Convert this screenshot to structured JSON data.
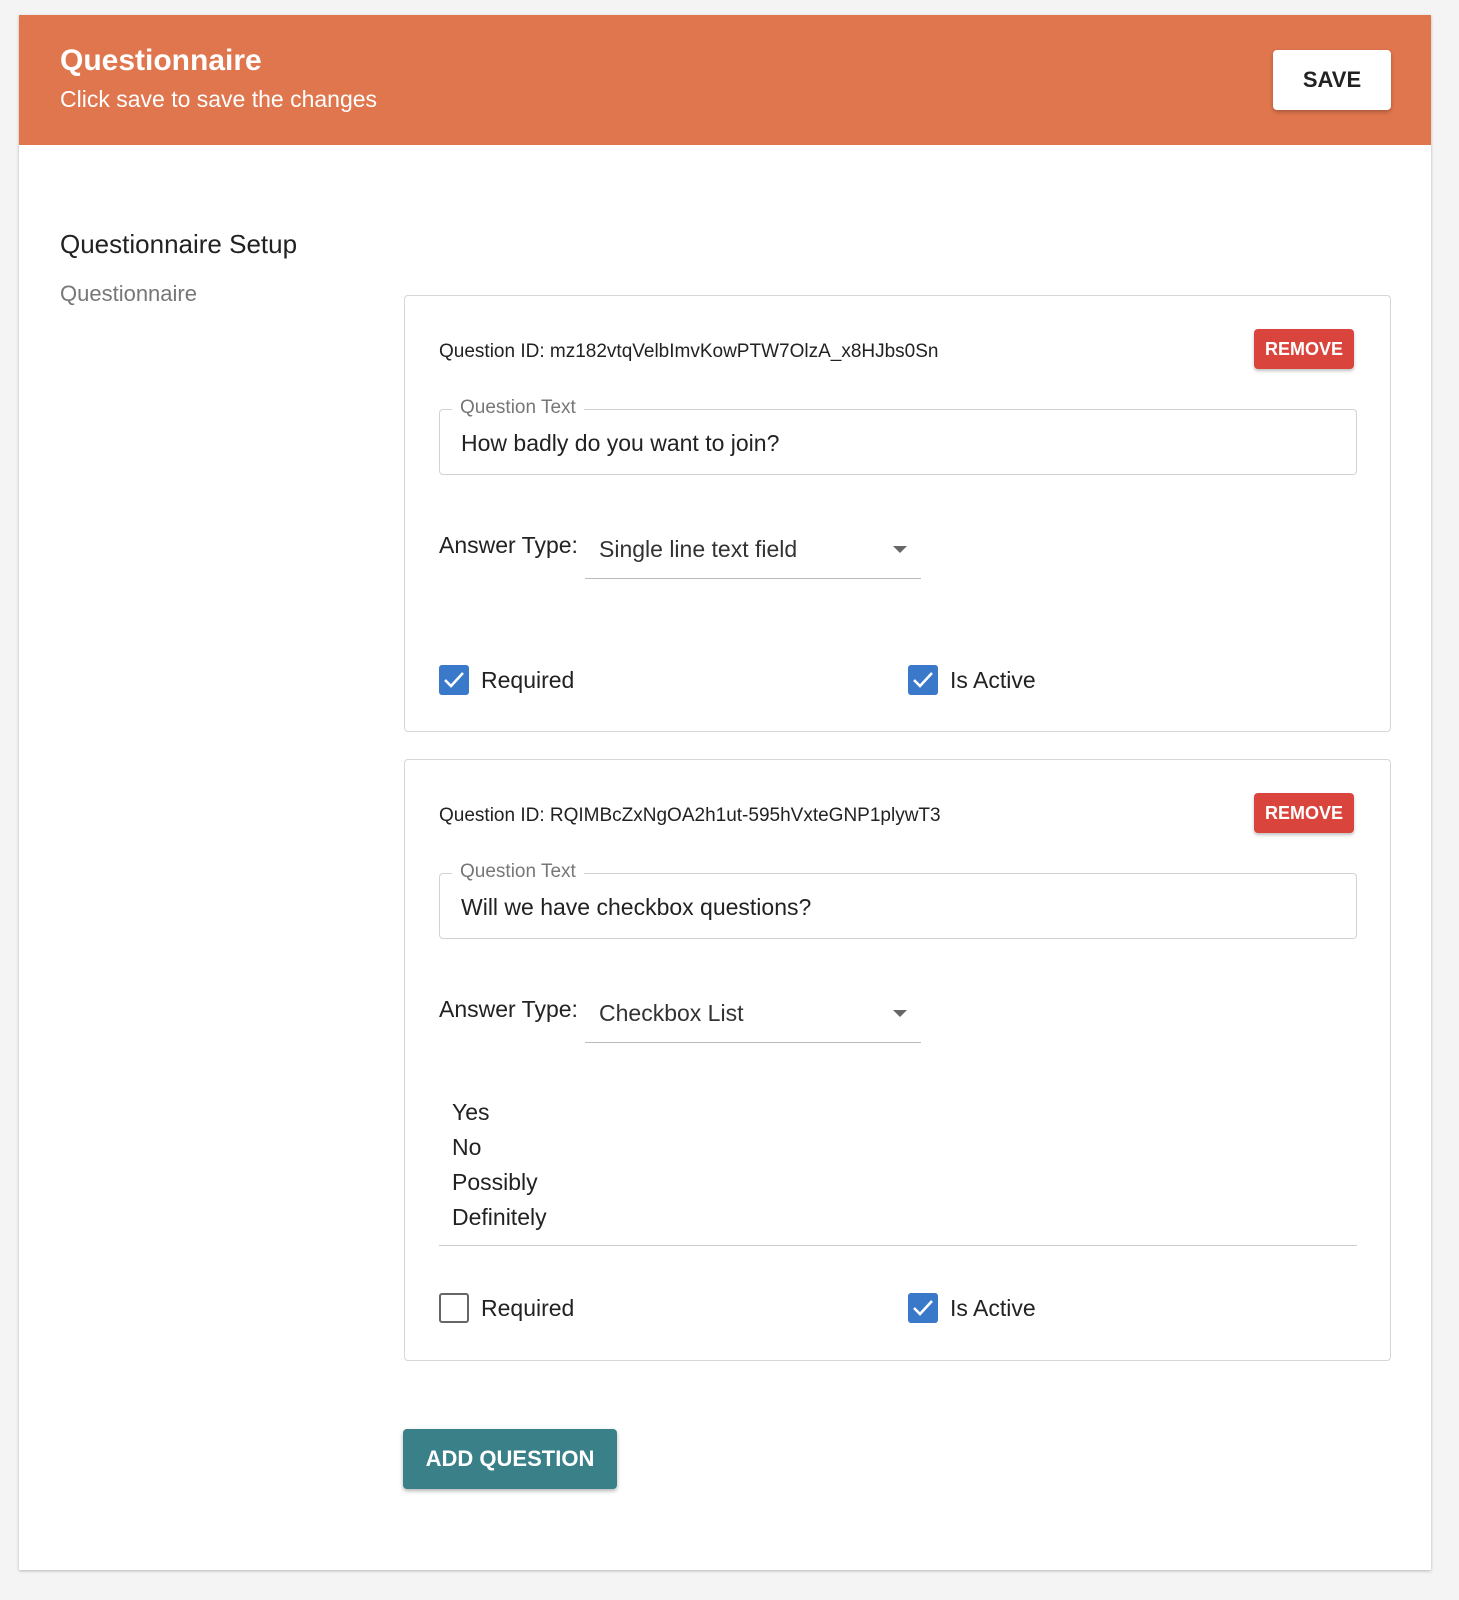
{
  "header": {
    "title": "Questionnaire",
    "subtitle": "Click save to save the changes",
    "save_label": "SAVE",
    "color": "#e0764d"
  },
  "section": {
    "title": "Questionnaire Setup",
    "subtitle": "Questionnaire"
  },
  "questions": [
    {
      "id_text": "Question ID: mz182vtqVelbImvKowPTW7OlzA_x8HJbs0Sn",
      "remove_label": "REMOVE",
      "text_label": "Question Text",
      "text_value": "How badly do you want to join?",
      "answer_type_label": "Answer Type:",
      "answer_type_value": "Single line text field",
      "required_label": "Required",
      "required_checked": true,
      "active_label": "Is Active",
      "active_checked": true
    },
    {
      "id_text": "Question ID: RQIMBcZxNgOA2h1ut-595hVxteGNP1plywT3",
      "remove_label": "REMOVE",
      "text_label": "Question Text",
      "text_value": "Will we have checkbox questions?",
      "answer_type_label": "Answer Type:",
      "answer_type_value": "Checkbox List",
      "options": [
        "Yes",
        "No",
        "Possibly",
        "Definitely"
      ],
      "required_label": "Required",
      "required_checked": false,
      "active_label": "Is Active",
      "active_checked": true
    }
  ],
  "add_question_label": "ADD QUESTION",
  "colors": {
    "remove": "#d9453c",
    "add_question": "#3a8089",
    "checkbox": "#3a78c9"
  },
  "icons": {
    "checkmark": "checkmark-icon",
    "dropdown": "dropdown-caret-icon"
  }
}
